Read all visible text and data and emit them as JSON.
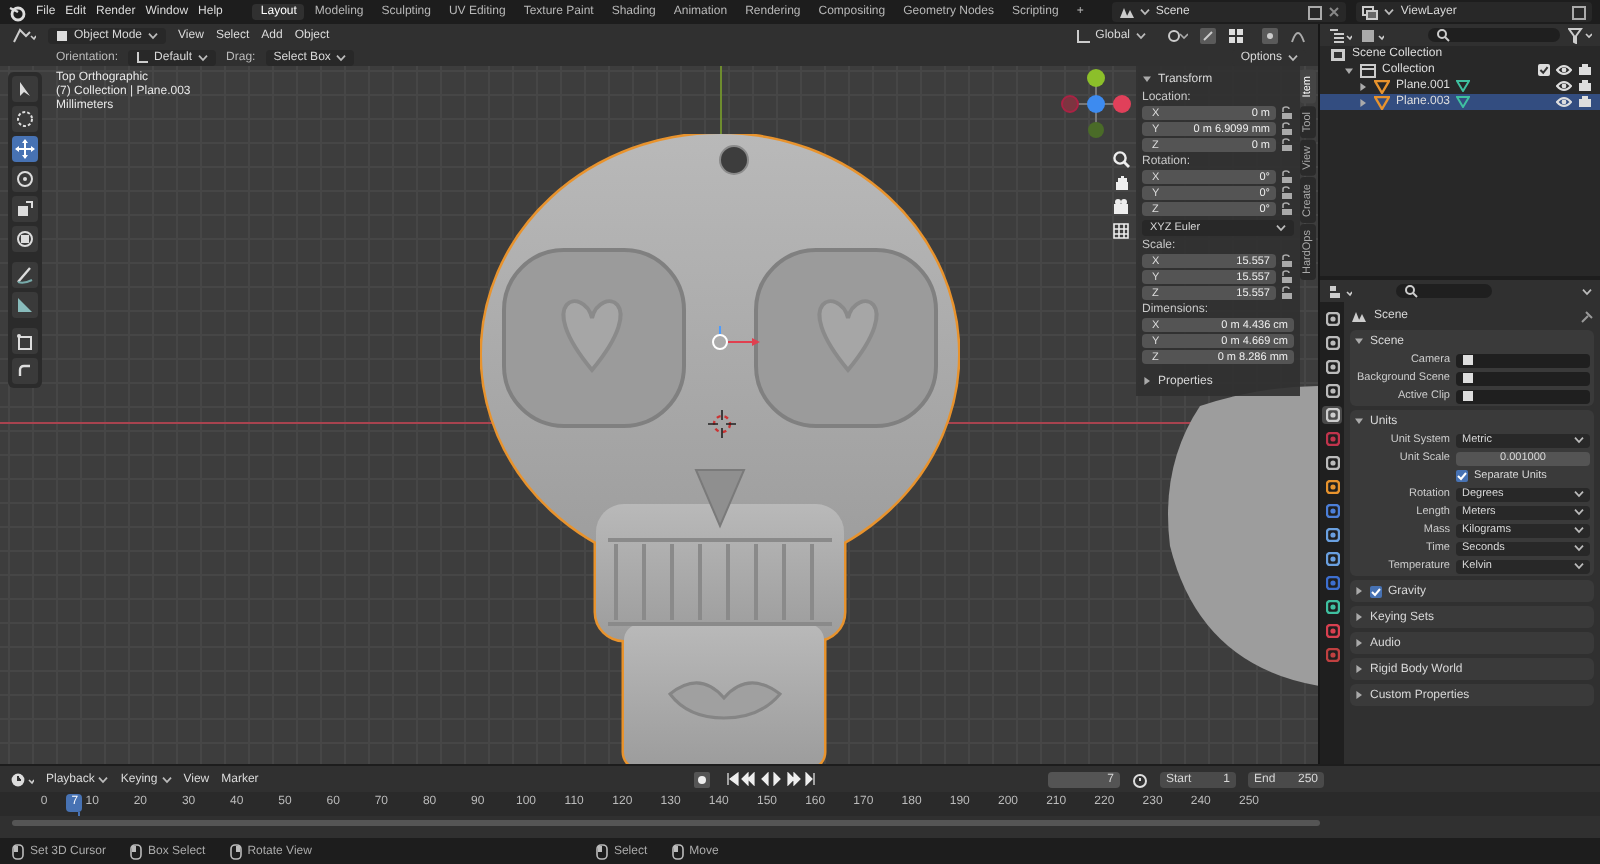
{
  "menu": [
    "File",
    "Edit",
    "Render",
    "Window",
    "Help"
  ],
  "workspaces": [
    {
      "label": "Layout",
      "selected": true
    },
    {
      "label": "Modeling",
      "selected": false
    },
    {
      "label": "Sculpting",
      "selected": false
    },
    {
      "label": "UV Editing",
      "selected": false
    },
    {
      "label": "Texture Paint",
      "selected": false
    },
    {
      "label": "Shading",
      "selected": false
    },
    {
      "label": "Animation",
      "selected": false
    },
    {
      "label": "Rendering",
      "selected": false
    },
    {
      "label": "Compositing",
      "selected": false
    },
    {
      "label": "Geometry Nodes",
      "selected": false
    },
    {
      "label": "Scripting",
      "selected": false
    }
  ],
  "add_workspace": "+",
  "scene": "Scene",
  "view_layer": "ViewLayer",
  "viewport": {
    "mode": "Object Mode",
    "menus": [
      "View",
      "Select",
      "Add",
      "Object"
    ],
    "transform_orientation": "Global",
    "orientation_label": "Orientation:",
    "orientation": "Default",
    "drag_label": "Drag:",
    "drag": "Select Box",
    "options": "Options",
    "overlay": [
      "Top Orthographic",
      "(7) Collection | Plane.003",
      "Millimeters"
    ],
    "tools": [
      {
        "selected": false
      },
      {
        "selected": false
      },
      {
        "selected": true
      },
      {
        "selected": false
      },
      {
        "selected": false
      },
      {
        "selected": false
      },
      {
        "selected": false
      },
      {
        "selected": false
      },
      {
        "selected": false
      },
      {
        "selected": false
      }
    ]
  },
  "sidebar": {
    "tabs": [
      {
        "label": "Item",
        "selected": true
      },
      {
        "label": "Tool",
        "selected": false
      },
      {
        "label": "View",
        "selected": false
      },
      {
        "label": "Create",
        "selected": false
      },
      {
        "label": "HardOps",
        "selected": false
      }
    ],
    "panel": "Transform",
    "groups": [
      {
        "label": "Location:",
        "fields": [
          {
            "axis": "X",
            "value": "0 m"
          },
          {
            "axis": "Y",
            "value": "0 m 6.9099 mm"
          },
          {
            "axis": "Z",
            "value": "0 m"
          }
        ],
        "locks": true
      },
      {
        "label": "Rotation:",
        "fields": [
          {
            "axis": "X",
            "value": "0°"
          },
          {
            "axis": "Y",
            "value": "0°"
          },
          {
            "axis": "Z",
            "value": "0°"
          }
        ],
        "locks": true,
        "mode": "XYZ Euler"
      },
      {
        "label": "Scale:",
        "fields": [
          {
            "axis": "X",
            "value": "15.557"
          },
          {
            "axis": "Y",
            "value": "15.557"
          },
          {
            "axis": "Z",
            "value": "15.557"
          }
        ],
        "locks": true
      },
      {
        "label": "Dimensions:",
        "fields": [
          {
            "axis": "X",
            "value": "0 m 4.436 cm"
          },
          {
            "axis": "Y",
            "value": "0 m 4.669 cm"
          },
          {
            "axis": "Z",
            "value": "0 m 8.286 mm"
          }
        ],
        "locks": false
      }
    ],
    "collapsed": "Properties"
  },
  "outliner": {
    "tree": [
      {
        "label": "Scene Collection",
        "kind": "scene_collection",
        "selected": false,
        "children": [
          {
            "label": "Collection",
            "kind": "collection",
            "expanded": true,
            "selected": false,
            "children": [
              {
                "label": "Plane.001",
                "kind": "object",
                "expanded": false,
                "selected": false
              },
              {
                "label": "Plane.003",
                "kind": "object",
                "expanded": false,
                "selected": true
              }
            ]
          }
        ]
      }
    ]
  },
  "properties": {
    "tabs": [
      {
        "selected": false
      },
      {
        "selected": false
      },
      {
        "selected": false
      },
      {
        "selected": false
      },
      {
        "selected": true
      },
      {
        "selected": false
      },
      {
        "selected": false
      },
      {
        "selected": false
      },
      {
        "selected": false
      },
      {
        "selected": false
      },
      {
        "selected": false
      },
      {
        "selected": false
      },
      {
        "selected": false
      },
      {
        "selected": false
      },
      {
        "selected": false
      }
    ],
    "title": "Scene",
    "panels": [
      {
        "title": "Scene",
        "expanded": true,
        "rows": [
          {
            "kind": "object_field",
            "label": "Camera"
          },
          {
            "kind": "object_field",
            "label": "Background Scene"
          },
          {
            "kind": "object_field",
            "label": "Active Clip"
          }
        ]
      },
      {
        "title": "Units",
        "expanded": true,
        "rows": [
          {
            "kind": "dropdown",
            "label": "Unit System",
            "value": "Metric"
          },
          {
            "kind": "number",
            "label": "Unit Scale",
            "value": "0.001000"
          },
          {
            "kind": "checkbox",
            "label": "Separate Units",
            "checked": true
          },
          {
            "kind": "dropdown",
            "label": "Rotation",
            "value": "Degrees"
          },
          {
            "kind": "dropdown",
            "label": "Length",
            "value": "Meters"
          },
          {
            "kind": "dropdown",
            "label": "Mass",
            "value": "Kilograms"
          },
          {
            "kind": "dropdown",
            "label": "Time",
            "value": "Seconds"
          },
          {
            "kind": "dropdown",
            "label": "Temperature",
            "value": "Kelvin"
          }
        ]
      },
      {
        "title": "Gravity",
        "expanded": false,
        "checked": true
      },
      {
        "title": "Keying Sets",
        "expanded": false
      },
      {
        "title": "Audio",
        "expanded": false
      },
      {
        "title": "Rigid Body World",
        "expanded": false
      },
      {
        "title": "Custom Properties",
        "expanded": false
      }
    ]
  },
  "timeline": {
    "menus": [
      "Playback",
      "Keying",
      "View",
      "Marker"
    ],
    "current_frame": "7",
    "playhead_frame": "7",
    "start_label": "Start",
    "start": "1",
    "end_label": "End",
    "end": "250",
    "ruler": [
      "0",
      "10",
      "20",
      "30",
      "40",
      "50",
      "60",
      "70",
      "80",
      "90",
      "100",
      "110",
      "120",
      "130",
      "140",
      "150",
      "160",
      "170",
      "180",
      "190",
      "200",
      "210",
      "220",
      "230",
      "240",
      "250"
    ]
  },
  "status_bar": [
    "Set 3D Cursor",
    "Box Select",
    "Rotate View",
    "Select",
    "Move"
  ]
}
